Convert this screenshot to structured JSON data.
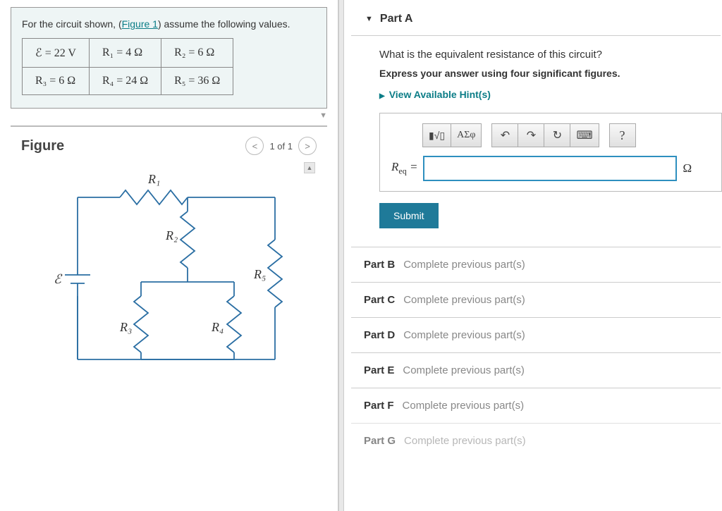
{
  "problem": {
    "intro_before": "For the circuit shown, (",
    "figure_link": "Figure 1",
    "intro_after": ") assume the following values.",
    "values": [
      [
        "ℰ = 22 V",
        "R₁ = 4 Ω",
        "R₂ = 6 Ω"
      ],
      [
        "R₃ = 6 Ω",
        "R₄ = 24 Ω",
        "R₅ = 36 Ω"
      ]
    ]
  },
  "figure": {
    "title": "Figure",
    "pager": "1 of 1",
    "labels": {
      "R1": "R₁",
      "R2": "R₂",
      "R3": "R₃",
      "R4": "R₄",
      "R5": "R₅",
      "E": "ℰ"
    }
  },
  "partA": {
    "title": "Part A",
    "question": "What is the equivalent resistance of this circuit?",
    "instruction": "Express your answer using four significant figures.",
    "hints": "View Available Hint(s)",
    "eq_label": "R",
    "eq_sub": "eq",
    "equals": " =",
    "unit": "Ω",
    "submit": "Submit",
    "tools": {
      "templates": "▮√▯",
      "greek": "ΑΣφ",
      "undo": "↶",
      "redo": "↷",
      "reset": "↻",
      "keyboard": "⌨",
      "help": "?"
    }
  },
  "locked": [
    {
      "label": "Part B",
      "msg": "Complete previous part(s)"
    },
    {
      "label": "Part C",
      "msg": "Complete previous part(s)"
    },
    {
      "label": "Part D",
      "msg": "Complete previous part(s)"
    },
    {
      "label": "Part E",
      "msg": "Complete previous part(s)"
    },
    {
      "label": "Part F",
      "msg": "Complete previous part(s)"
    },
    {
      "label": "Part G",
      "msg": "Complete previous part(s)"
    }
  ]
}
